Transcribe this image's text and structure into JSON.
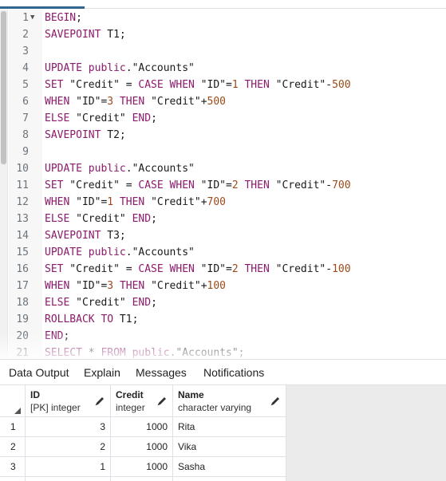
{
  "editor": {
    "lines": [
      {
        "n": "1",
        "fold": "▼",
        "tokens": [
          {
            "t": "BEGIN",
            "c": "kw"
          },
          {
            "t": ";",
            "c": "plain"
          }
        ]
      },
      {
        "n": "2",
        "tokens": [
          {
            "t": "SAVEPOINT",
            "c": "kw"
          },
          {
            "t": " T1;",
            "c": "plain"
          }
        ]
      },
      {
        "n": "3",
        "tokens": []
      },
      {
        "n": "4",
        "tokens": [
          {
            "t": "UPDATE",
            "c": "kw"
          },
          {
            "t": " ",
            "c": "plain"
          },
          {
            "t": "public",
            "c": "kw"
          },
          {
            "t": ".\"Accounts\"",
            "c": "str"
          }
        ]
      },
      {
        "n": "5",
        "tokens": [
          {
            "t": "SET",
            "c": "kw"
          },
          {
            "t": " \"Credit\" = ",
            "c": "str"
          },
          {
            "t": "CASE",
            "c": "kw"
          },
          {
            "t": " ",
            "c": "plain"
          },
          {
            "t": "WHEN",
            "c": "kw"
          },
          {
            "t": " \"ID\"=",
            "c": "str"
          },
          {
            "t": "1",
            "c": "num"
          },
          {
            "t": " ",
            "c": "plain"
          },
          {
            "t": "THEN",
            "c": "kw"
          },
          {
            "t": " \"Credit\"-",
            "c": "str"
          },
          {
            "t": "500",
            "c": "num"
          }
        ]
      },
      {
        "n": "6",
        "tokens": [
          {
            "t": "WHEN",
            "c": "kw"
          },
          {
            "t": " \"ID\"=",
            "c": "str"
          },
          {
            "t": "3",
            "c": "num"
          },
          {
            "t": " ",
            "c": "plain"
          },
          {
            "t": "THEN",
            "c": "kw"
          },
          {
            "t": " \"Credit\"+",
            "c": "str"
          },
          {
            "t": "500",
            "c": "num"
          }
        ]
      },
      {
        "n": "7",
        "tokens": [
          {
            "t": "ELSE",
            "c": "kw"
          },
          {
            "t": " \"Credit\" ",
            "c": "str"
          },
          {
            "t": "END",
            "c": "kw"
          },
          {
            "t": ";",
            "c": "plain"
          }
        ]
      },
      {
        "n": "8",
        "tokens": [
          {
            "t": "SAVEPOINT",
            "c": "kw"
          },
          {
            "t": " T2;",
            "c": "plain"
          }
        ]
      },
      {
        "n": "9",
        "tokens": []
      },
      {
        "n": "10",
        "tokens": [
          {
            "t": "UPDATE",
            "c": "kw"
          },
          {
            "t": " ",
            "c": "plain"
          },
          {
            "t": "public",
            "c": "kw"
          },
          {
            "t": ".\"Accounts\"",
            "c": "str"
          }
        ]
      },
      {
        "n": "11",
        "tokens": [
          {
            "t": "SET",
            "c": "kw"
          },
          {
            "t": " \"Credit\" = ",
            "c": "str"
          },
          {
            "t": "CASE",
            "c": "kw"
          },
          {
            "t": " ",
            "c": "plain"
          },
          {
            "t": "WHEN",
            "c": "kw"
          },
          {
            "t": " \"ID\"=",
            "c": "str"
          },
          {
            "t": "2",
            "c": "num"
          },
          {
            "t": " ",
            "c": "plain"
          },
          {
            "t": "THEN",
            "c": "kw"
          },
          {
            "t": " \"Credit\"-",
            "c": "str"
          },
          {
            "t": "700",
            "c": "num"
          }
        ]
      },
      {
        "n": "12",
        "tokens": [
          {
            "t": "WHEN",
            "c": "kw"
          },
          {
            "t": " \"ID\"=",
            "c": "str"
          },
          {
            "t": "1",
            "c": "num"
          },
          {
            "t": " ",
            "c": "plain"
          },
          {
            "t": "THEN",
            "c": "kw"
          },
          {
            "t": " \"Credit\"+",
            "c": "str"
          },
          {
            "t": "700",
            "c": "num"
          }
        ]
      },
      {
        "n": "13",
        "tokens": [
          {
            "t": "ELSE",
            "c": "kw"
          },
          {
            "t": " \"Credit\" ",
            "c": "str"
          },
          {
            "t": "END",
            "c": "kw"
          },
          {
            "t": ";",
            "c": "plain"
          }
        ]
      },
      {
        "n": "14",
        "tokens": [
          {
            "t": "SAVEPOINT",
            "c": "kw"
          },
          {
            "t": " T3;",
            "c": "plain"
          }
        ]
      },
      {
        "n": "15",
        "tokens": [
          {
            "t": "UPDATE",
            "c": "kw"
          },
          {
            "t": " ",
            "c": "plain"
          },
          {
            "t": "public",
            "c": "kw"
          },
          {
            "t": ".\"Accounts\"",
            "c": "str"
          }
        ]
      },
      {
        "n": "16",
        "tokens": [
          {
            "t": "SET",
            "c": "kw"
          },
          {
            "t": " \"Credit\" = ",
            "c": "str"
          },
          {
            "t": "CASE",
            "c": "kw"
          },
          {
            "t": " ",
            "c": "plain"
          },
          {
            "t": "WHEN",
            "c": "kw"
          },
          {
            "t": " \"ID\"=",
            "c": "str"
          },
          {
            "t": "2",
            "c": "num"
          },
          {
            "t": " ",
            "c": "plain"
          },
          {
            "t": "THEN",
            "c": "kw"
          },
          {
            "t": " \"Credit\"-",
            "c": "str"
          },
          {
            "t": "100",
            "c": "num"
          }
        ]
      },
      {
        "n": "17",
        "tokens": [
          {
            "t": "WHEN",
            "c": "kw"
          },
          {
            "t": " \"ID\"=",
            "c": "str"
          },
          {
            "t": "3",
            "c": "num"
          },
          {
            "t": " ",
            "c": "plain"
          },
          {
            "t": "THEN",
            "c": "kw"
          },
          {
            "t": " \"Credit\"+",
            "c": "str"
          },
          {
            "t": "100",
            "c": "num"
          }
        ]
      },
      {
        "n": "18",
        "tokens": [
          {
            "t": "ELSE",
            "c": "kw"
          },
          {
            "t": " \"Credit\" ",
            "c": "str"
          },
          {
            "t": "END",
            "c": "kw"
          },
          {
            "t": ";",
            "c": "plain"
          }
        ]
      },
      {
        "n": "19",
        "tokens": [
          {
            "t": "ROLLBACK",
            "c": "kw"
          },
          {
            "t": " ",
            "c": "plain"
          },
          {
            "t": "TO",
            "c": "kw"
          },
          {
            "t": " T1;",
            "c": "plain"
          }
        ]
      },
      {
        "n": "20",
        "tokens": [
          {
            "t": "END",
            "c": "kw"
          },
          {
            "t": ";",
            "c": "plain"
          }
        ]
      },
      {
        "n": "21",
        "tokens": [
          {
            "t": "SELECT",
            "c": "kw"
          },
          {
            "t": " * ",
            "c": "plain"
          },
          {
            "t": "FROM",
            "c": "kw"
          },
          {
            "t": " ",
            "c": "plain"
          },
          {
            "t": "public",
            "c": "kw"
          },
          {
            "t": ".\"Accounts\";",
            "c": "str"
          }
        ]
      }
    ]
  },
  "panel": {
    "tabs": [
      "Data Output",
      "Explain",
      "Messages",
      "Notifications"
    ]
  },
  "grid": {
    "columns": [
      {
        "name": "ID",
        "type": "[PK] integer"
      },
      {
        "name": "Credit",
        "type": "integer"
      },
      {
        "name": "Name",
        "type": "character varying"
      }
    ],
    "rows": [
      {
        "num": "1",
        "id": "3",
        "credit": "1000",
        "name": "Rita"
      },
      {
        "num": "2",
        "id": "2",
        "credit": "1000",
        "name": "Vika"
      },
      {
        "num": "3",
        "id": "1",
        "credit": "1000",
        "name": "Sasha"
      }
    ]
  },
  "colors": {
    "keyword": "#8b1a6b",
    "number": "#9c4a19",
    "accent": "#326690"
  }
}
